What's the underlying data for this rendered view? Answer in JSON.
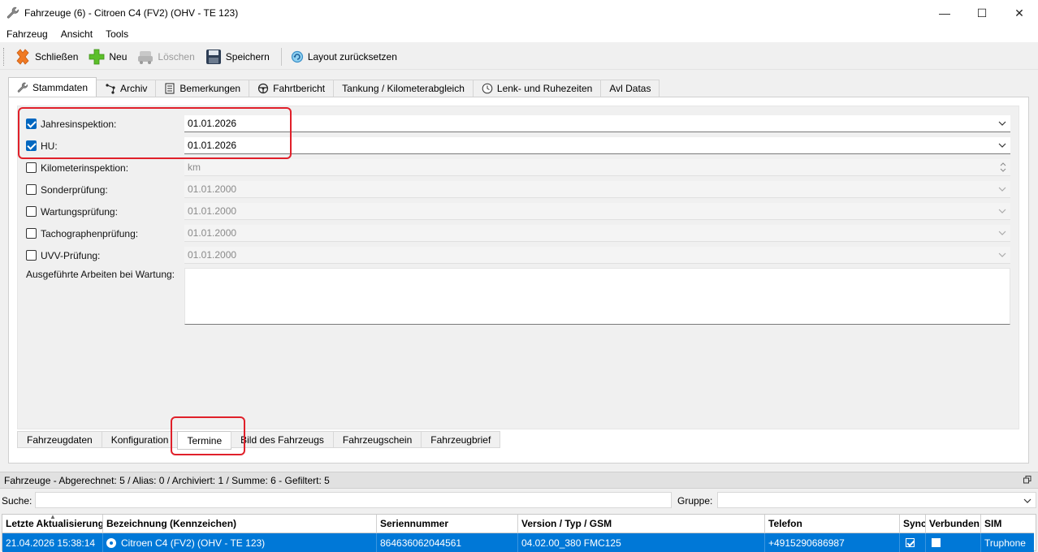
{
  "window": {
    "title": "Fahrzeuge (6) - Citroen C4 (FV2) (OHV - TE 123)",
    "minimize_glyph": "—",
    "maximize_glyph": "☐",
    "close_glyph": "✕"
  },
  "menu": {
    "items": [
      "Fahrzeug",
      "Ansicht",
      "Tools"
    ]
  },
  "toolbar": {
    "close_label": "Schließen",
    "new_label": "Neu",
    "delete_label": "Löschen",
    "save_label": "Speichern",
    "reset_layout_label": "Layout zurücksetzen"
  },
  "top_tabs": [
    "Stammdaten",
    "Archiv",
    "Bemerkungen",
    "Fahrtbericht",
    "Tankung / Kilometerabgleich",
    "Lenk- und Ruhezeiten",
    "Avl Datas"
  ],
  "form": {
    "rows": [
      {
        "label": "Jahresinspektion:",
        "value": "01.01.2026",
        "checked": true
      },
      {
        "label": "HU:",
        "value": "01.01.2026",
        "checked": true
      },
      {
        "label": "Kilometerinspektion:",
        "value": "km",
        "checked": false
      },
      {
        "label": "Sonderprüfung:",
        "value": "01.01.2000",
        "checked": false
      },
      {
        "label": "Wartungsprüfung:",
        "value": "01.01.2000",
        "checked": false
      },
      {
        "label": "Tachographenprüfung:",
        "value": "01.01.2000",
        "checked": false
      },
      {
        "label": "UVV-Prüfung:",
        "value": "01.01.2000",
        "checked": false
      }
    ],
    "memo_label": "Ausgeführte Arbeiten bei Wartung:",
    "memo_value": ""
  },
  "bottom_tabs": [
    "Fahrzeugdaten",
    "Konfiguration",
    "Termine",
    "Bild des Fahrzeugs",
    "Fahrzeugschein",
    "Fahrzeugbrief"
  ],
  "status": {
    "text": "Fahrzeuge - Abgerechnet: 5 / Alias: 0 / Archiviert: 1 / Summe: 6 - Gefiltert: 5"
  },
  "search": {
    "label": "Suche:",
    "value": "",
    "group_label": "Gruppe:",
    "group_value": ""
  },
  "grid": {
    "columns": [
      "Letzte Aktualisierung",
      "Bezeichnung (Kennzeichen)",
      "Seriennummer",
      "Version / Typ / GSM",
      "Telefon",
      "Sync",
      "Verbunden",
      "SIM"
    ],
    "rows": [
      {
        "updated": "21.04.2026 15:38:14",
        "name": "Citroen C4 (FV2) (OHV - TE 123)",
        "serial": "864636062044561",
        "version": "04.02.00_380 FMC125",
        "phone": "+4915290686987",
        "sync": true,
        "connected": false,
        "sim": "Truphone"
      }
    ]
  },
  "colors": {
    "accent": "#0067c0",
    "selection": "#0078d7",
    "highlight": "#e0202a"
  }
}
